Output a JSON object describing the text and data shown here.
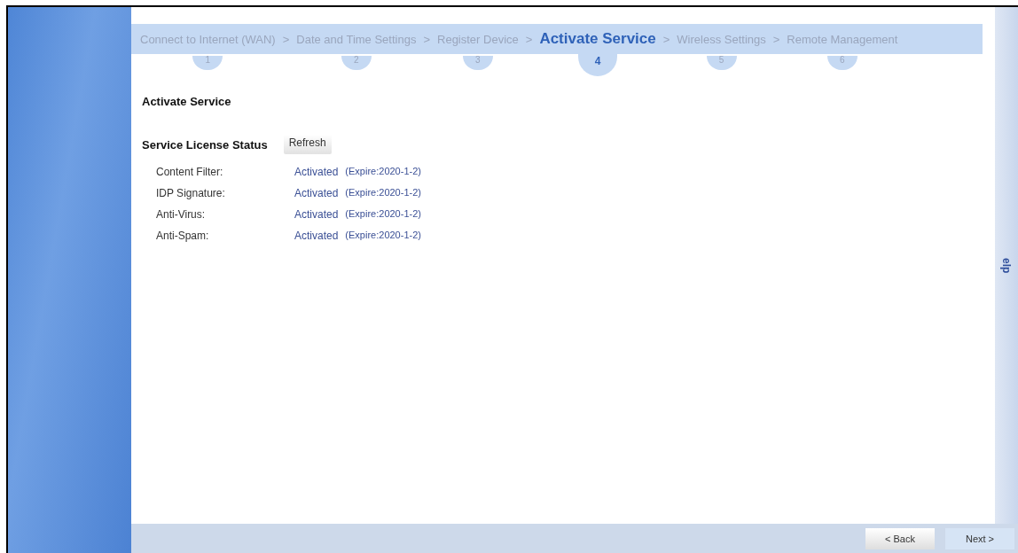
{
  "wizard_steps": [
    {
      "label": "Connect to Internet (WAN)",
      "number": "1",
      "selected": false
    },
    {
      "label": "Date and Time Settings",
      "number": "2",
      "selected": false
    },
    {
      "label": "Register Device",
      "number": "3",
      "selected": false
    },
    {
      "label": "Activate Service",
      "number": "4",
      "selected": true
    },
    {
      "label": "Wireless Settings",
      "number": "5",
      "selected": false
    },
    {
      "label": "Remote Management",
      "number": "6",
      "selected": false
    }
  ],
  "separator": ">",
  "help_tab": "elp",
  "page_title": "Activate Service",
  "license_section": {
    "title": "Service License Status",
    "refresh_button": "Refresh"
  },
  "services": [
    {
      "name": "Content Filter:",
      "status": "Activated",
      "expiry": "(Expire:2020-1-2)"
    },
    {
      "name": "IDP Signature:",
      "status": "Activated",
      "expiry": "(Expire:2020-1-2)"
    },
    {
      "name": "Anti-Virus:",
      "status": "Activated",
      "expiry": "(Expire:2020-1-2)"
    },
    {
      "name": "Anti-Spam:",
      "status": "Activated",
      "expiry": "(Expire:2020-1-2)"
    }
  ],
  "buttons": {
    "back": "< Back",
    "next": "Next >"
  }
}
